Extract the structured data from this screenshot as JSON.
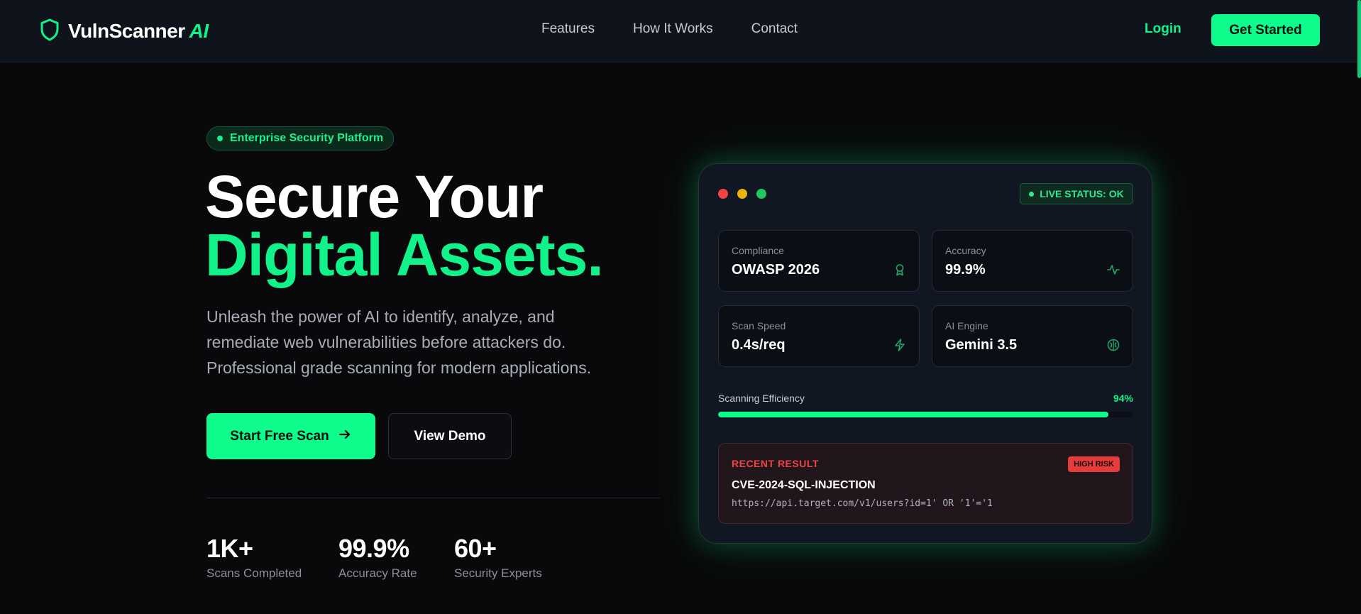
{
  "nav": {
    "logo_name": "VulnScanner",
    "logo_ai": "AI",
    "links": [
      "Features",
      "How It Works",
      "Contact"
    ],
    "login_label": "Login",
    "cta_label": "Get Started"
  },
  "hero": {
    "badge": "Enterprise Security Platform",
    "title_line1": "Secure Your",
    "title_line2": "Digital Assets.",
    "subtitle_line1": "Unleash the power of AI to identify, analyze, and",
    "subtitle_line2": "remediate web vulnerabilities before attackers do.",
    "subtitle_line3": "Professional grade scanning for modern applications.",
    "primary_button": "Start Free Scan",
    "secondary_button": "View Demo",
    "stats": [
      {
        "value": "1K+",
        "label": "Scans Completed"
      },
      {
        "value": "99.9%",
        "label": "Accuracy Rate"
      },
      {
        "value": "60+",
        "label": "Security Experts"
      }
    ]
  },
  "dashboard": {
    "live_status": "LIVE STATUS: OK",
    "metrics": [
      {
        "label": "Compliance",
        "value": "OWASP 2026",
        "icon": "award-icon"
      },
      {
        "label": "Accuracy",
        "value": "99.9%",
        "icon": "activity-icon"
      },
      {
        "label": "Scan Speed",
        "value": "0.4s/req",
        "icon": "zap-icon"
      },
      {
        "label": "AI Engine",
        "value": "Gemini 3.5",
        "icon": "brain-icon"
      }
    ],
    "efficiency_label": "Scanning Efficiency",
    "efficiency_text": "94%",
    "efficiency_value": 0.94,
    "recent_result": {
      "label": "RECENT RESULT",
      "risk_badge": "HIGH RISK",
      "title": "CVE-2024-SQL-INJECTION",
      "url": "https://api.target.com/v1/users?id=1' OR '1'='1"
    }
  },
  "colors": {
    "accent": "#0dfc8c",
    "background": "#09090b",
    "danger": "#ef4444",
    "window_red": "#ef4444",
    "window_yellow": "#eab308",
    "window_green": "#22c55e"
  }
}
